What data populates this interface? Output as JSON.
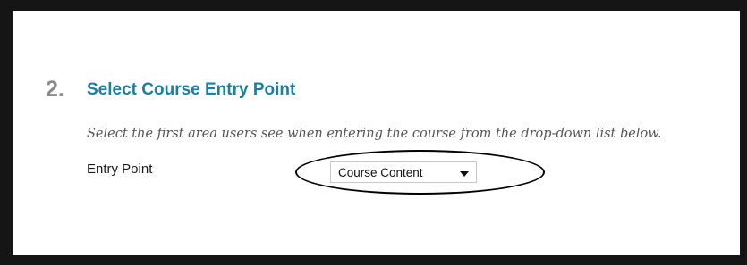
{
  "section": {
    "step_number": "2.",
    "title": "Select Course Entry Point",
    "instructions": "Select the first area users see when entering the course from the drop-down list below."
  },
  "entry_point": {
    "label": "Entry Point",
    "selected_value": "Course Content",
    "caret_icon": "chevron-down-icon"
  },
  "annotation": {
    "shape": "ellipse",
    "color": "#000000"
  },
  "colors": {
    "frame": "#151515",
    "title": "#1a7fa0",
    "step_number": "#8a8a8a",
    "instructions": "#555555"
  }
}
